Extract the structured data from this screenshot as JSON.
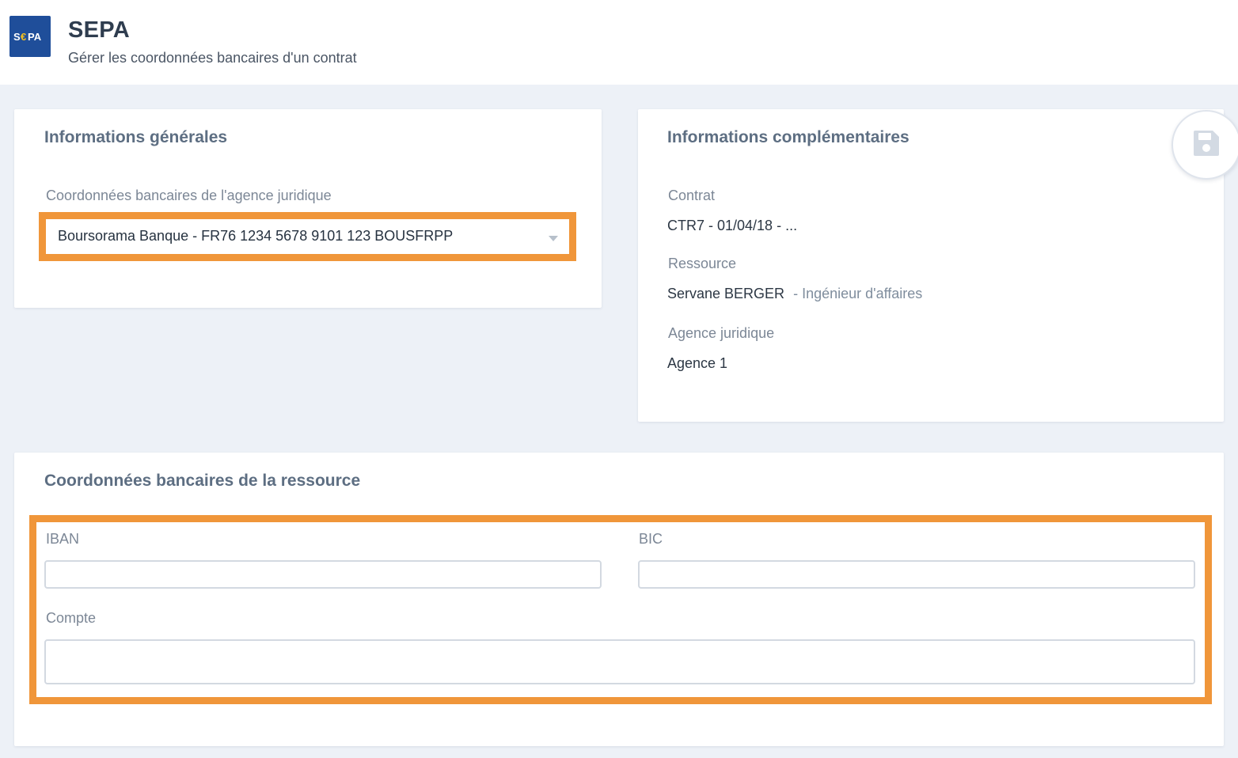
{
  "header": {
    "logo_text": "S€PA",
    "title": "SEPA",
    "subtitle": "Gérer les coordonnées bancaires d'un contrat"
  },
  "general": {
    "title": "Informations générales",
    "bank_label": "Coordonnées bancaires de l'agence juridique",
    "bank_value": "Boursorama Banque - FR76 1234 5678 9101 123 BOUSFRPP"
  },
  "complementary": {
    "title": "Informations complémentaires",
    "contract_label": "Contrat",
    "contract_value": "CTR7 - 01/04/18 - ...",
    "resource_label": "Ressource",
    "resource_name": "Servane BERGER",
    "resource_role": "- Ingénieur d'affaires",
    "agency_label": "Agence juridique",
    "agency_value": "Agence 1"
  },
  "resource_bank": {
    "title": "Coordonnées bancaires de la ressource",
    "iban_label": "IBAN",
    "iban_value": "",
    "bic_label": "BIC",
    "bic_value": "",
    "account_label": "Compte",
    "account_value": ""
  },
  "actions": {
    "save_icon": "save-icon"
  },
  "colors": {
    "highlight": "#f0963a",
    "logo_bg": "#1f4e9a",
    "background": "#edf1f7"
  }
}
